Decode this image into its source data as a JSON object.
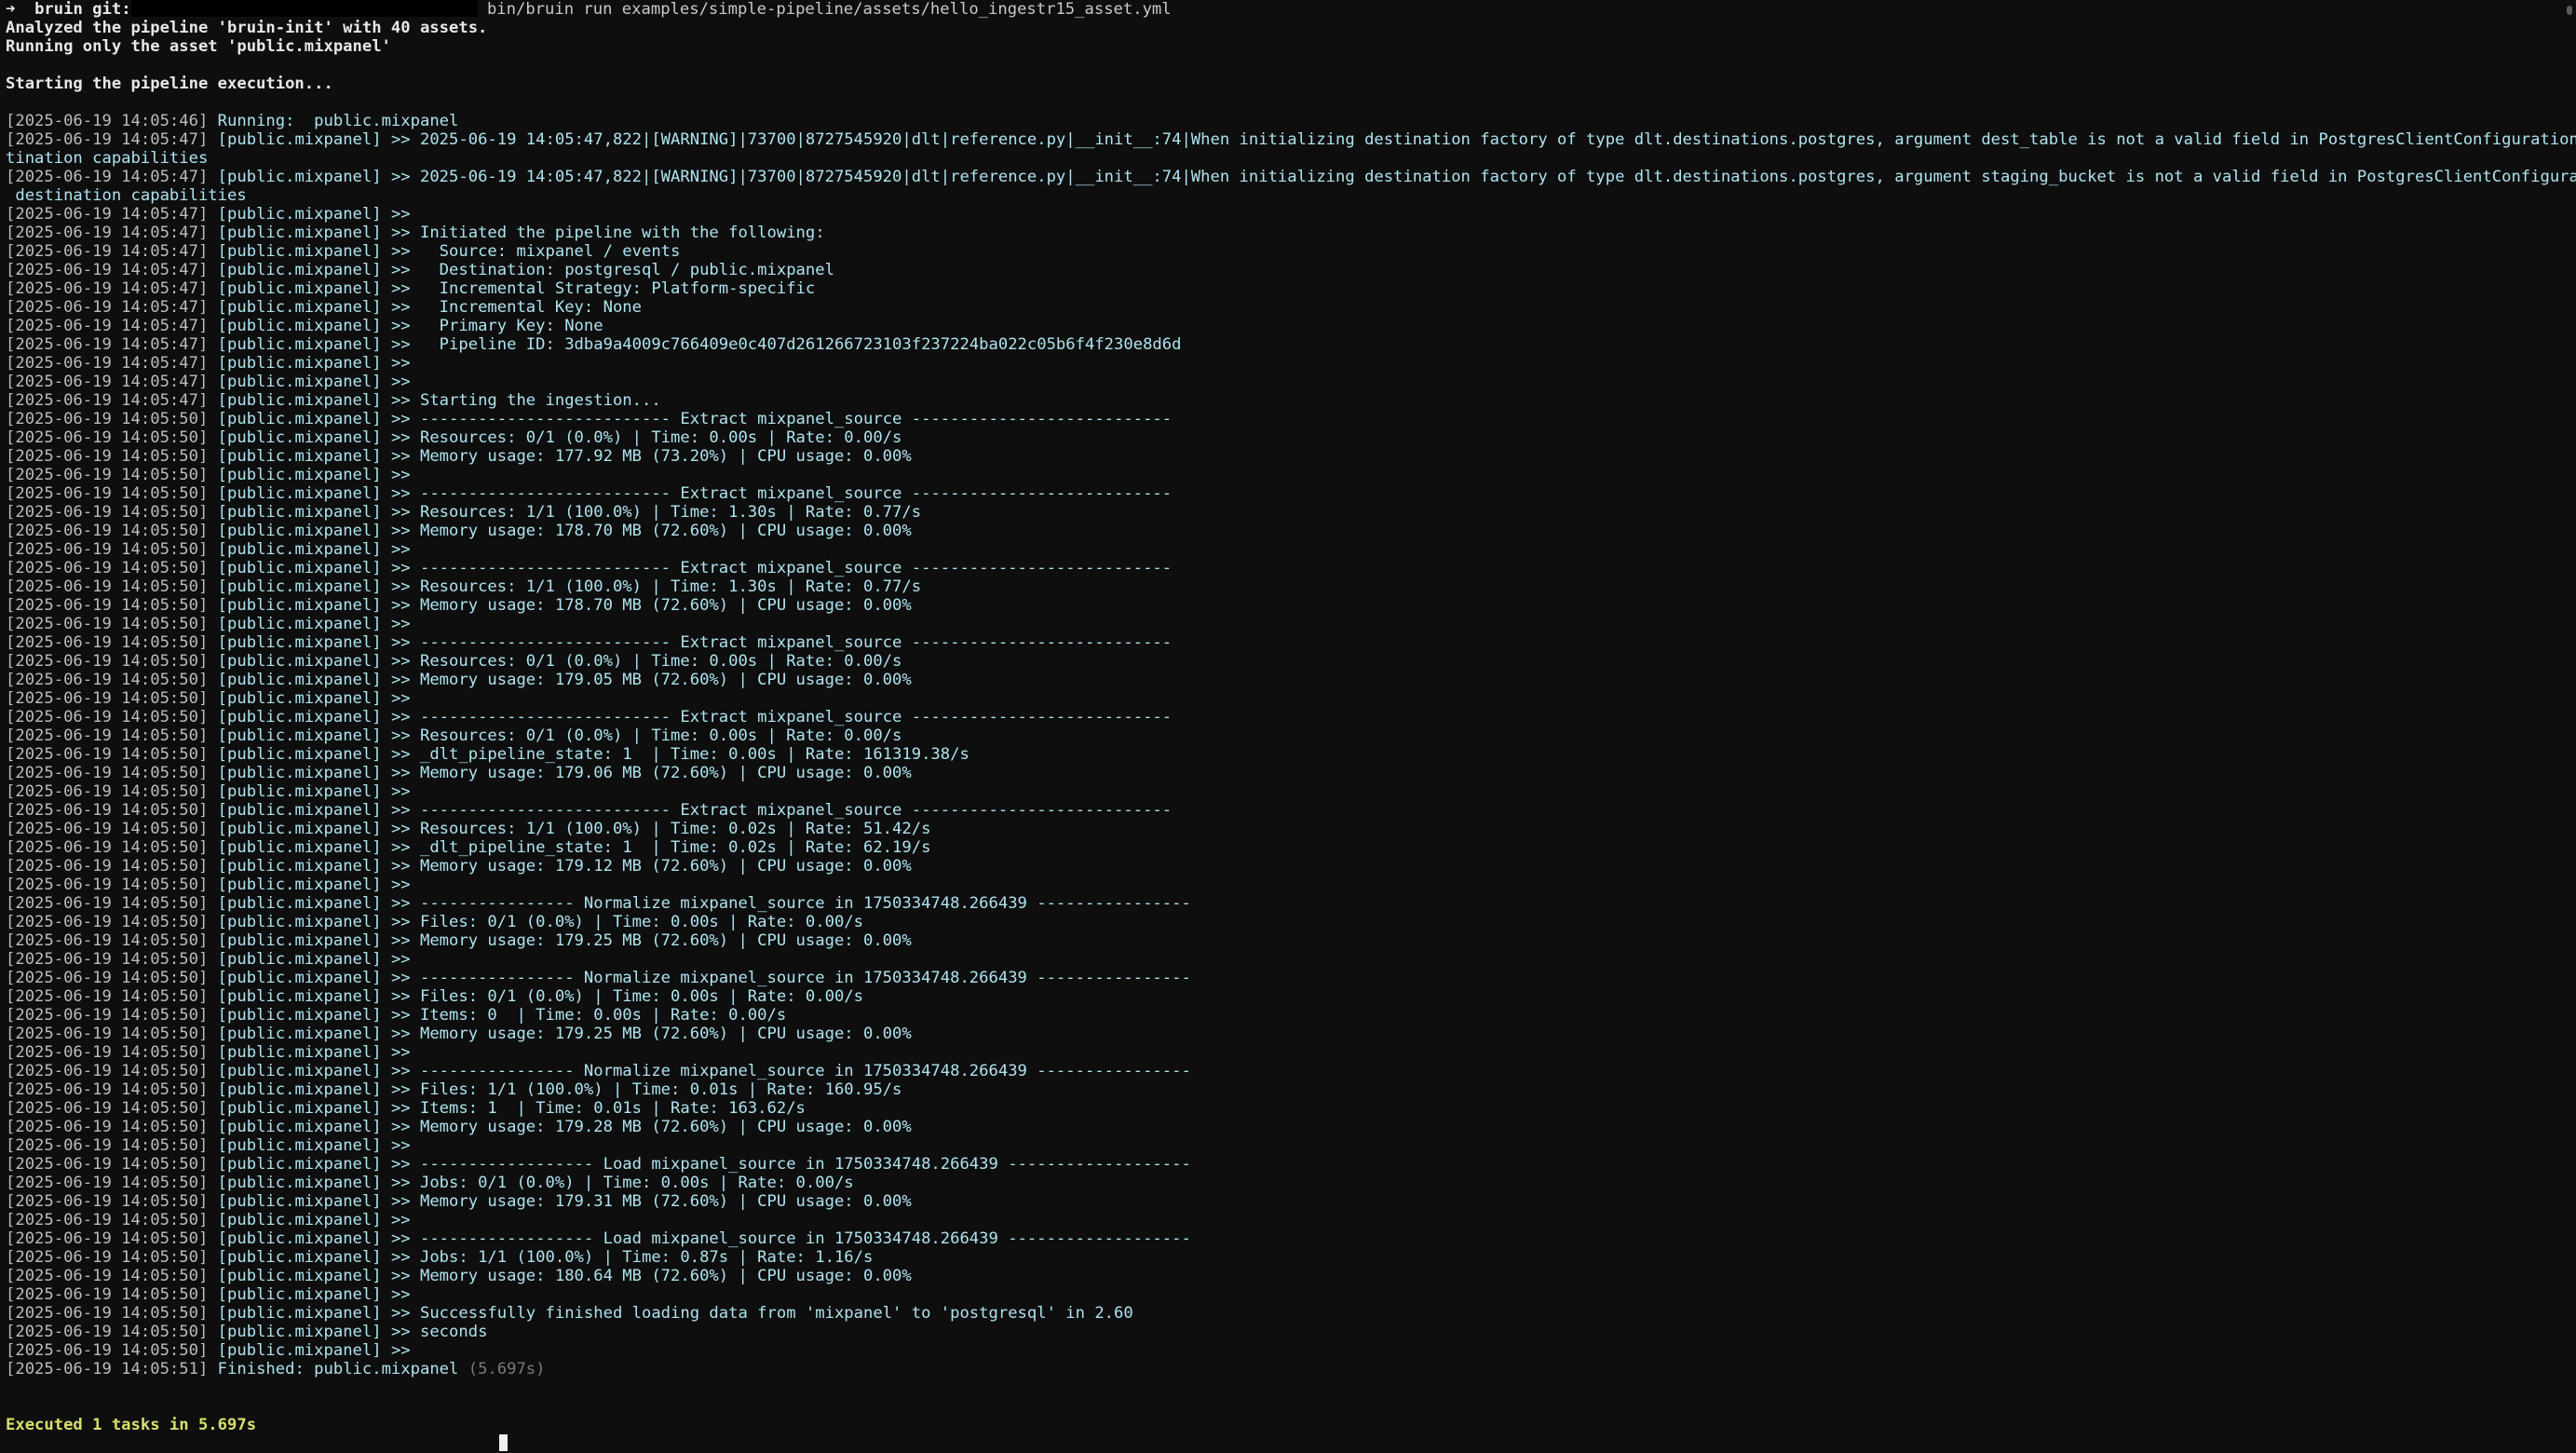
{
  "prompt": {
    "arrow": "➜",
    "dir": "bruin",
    "git_label": "git:",
    "command": "bin/bruin run examples/simple-pipeline/assets/hello_ingestr15_asset.yml"
  },
  "header": {
    "analyzed": "Analyzed the pipeline 'bruin-init' with 40 assets.",
    "running_only": "Running only the asset 'public.mixpanel'",
    "starting": "Starting the pipeline execution..."
  },
  "log": [
    {
      "ts": "[2025-06-19 14:05:46]",
      "asset": "Running:  public.mixpanel",
      "msg": ""
    },
    {
      "ts": "[2025-06-19 14:05:47]",
      "asset": "[public.mixpanel]",
      "msg": " >> 2025-06-19 14:05:47,822|[WARNING]|73700|8727545920|dlt|reference.py|__init__:74|When initializing destination factory of type dlt.destinations.postgres, argument dest_table is not a valid field in PostgresClientConfiguration or des",
      "cont": "tination capabilities"
    },
    {
      "ts": "[2025-06-19 14:05:47]",
      "asset": "[public.mixpanel]",
      "msg": " >> 2025-06-19 14:05:47,822|[WARNING]|73700|8727545920|dlt|reference.py|__init__:74|When initializing destination factory of type dlt.destinations.postgres, argument staging_bucket is not a valid field in PostgresClientConfiguration or",
      "cont": " destination capabilities"
    },
    {
      "ts": "[2025-06-19 14:05:47]",
      "asset": "[public.mixpanel]",
      "msg": " >>"
    },
    {
      "ts": "[2025-06-19 14:05:47]",
      "asset": "[public.mixpanel]",
      "msg": " >> Initiated the pipeline with the following:"
    },
    {
      "ts": "[2025-06-19 14:05:47]",
      "asset": "[public.mixpanel]",
      "msg": " >>   Source: mixpanel / events"
    },
    {
      "ts": "[2025-06-19 14:05:47]",
      "asset": "[public.mixpanel]",
      "msg": " >>   Destination: postgresql / public.mixpanel"
    },
    {
      "ts": "[2025-06-19 14:05:47]",
      "asset": "[public.mixpanel]",
      "msg": " >>   Incremental Strategy: Platform-specific"
    },
    {
      "ts": "[2025-06-19 14:05:47]",
      "asset": "[public.mixpanel]",
      "msg": " >>   Incremental Key: None"
    },
    {
      "ts": "[2025-06-19 14:05:47]",
      "asset": "[public.mixpanel]",
      "msg": " >>   Primary Key: None"
    },
    {
      "ts": "[2025-06-19 14:05:47]",
      "asset": "[public.mixpanel]",
      "msg": " >>   Pipeline ID: 3dba9a4009c766409e0c407d261266723103f237224ba022c05b6f4f230e8d6d"
    },
    {
      "ts": "[2025-06-19 14:05:47]",
      "asset": "[public.mixpanel]",
      "msg": " >>"
    },
    {
      "ts": "[2025-06-19 14:05:47]",
      "asset": "[public.mixpanel]",
      "msg": " >>"
    },
    {
      "ts": "[2025-06-19 14:05:47]",
      "asset": "[public.mixpanel]",
      "msg": " >> Starting the ingestion..."
    },
    {
      "ts": "[2025-06-19 14:05:50]",
      "asset": "[public.mixpanel]",
      "msg": " >> -------------------------- Extract mixpanel_source ---------------------------"
    },
    {
      "ts": "[2025-06-19 14:05:50]",
      "asset": "[public.mixpanel]",
      "msg": " >> Resources: 0/1 (0.0%) | Time: 0.00s | Rate: 0.00/s"
    },
    {
      "ts": "[2025-06-19 14:05:50]",
      "asset": "[public.mixpanel]",
      "msg": " >> Memory usage: 177.92 MB (73.20%) | CPU usage: 0.00%"
    },
    {
      "ts": "[2025-06-19 14:05:50]",
      "asset": "[public.mixpanel]",
      "msg": " >>"
    },
    {
      "ts": "[2025-06-19 14:05:50]",
      "asset": "[public.mixpanel]",
      "msg": " >> -------------------------- Extract mixpanel_source ---------------------------"
    },
    {
      "ts": "[2025-06-19 14:05:50]",
      "asset": "[public.mixpanel]",
      "msg": " >> Resources: 1/1 (100.0%) | Time: 1.30s | Rate: 0.77/s"
    },
    {
      "ts": "[2025-06-19 14:05:50]",
      "asset": "[public.mixpanel]",
      "msg": " >> Memory usage: 178.70 MB (72.60%) | CPU usage: 0.00%"
    },
    {
      "ts": "[2025-06-19 14:05:50]",
      "asset": "[public.mixpanel]",
      "msg": " >>"
    },
    {
      "ts": "[2025-06-19 14:05:50]",
      "asset": "[public.mixpanel]",
      "msg": " >> -------------------------- Extract mixpanel_source ---------------------------"
    },
    {
      "ts": "[2025-06-19 14:05:50]",
      "asset": "[public.mixpanel]",
      "msg": " >> Resources: 1/1 (100.0%) | Time: 1.30s | Rate: 0.77/s"
    },
    {
      "ts": "[2025-06-19 14:05:50]",
      "asset": "[public.mixpanel]",
      "msg": " >> Memory usage: 178.70 MB (72.60%) | CPU usage: 0.00%"
    },
    {
      "ts": "[2025-06-19 14:05:50]",
      "asset": "[public.mixpanel]",
      "msg": " >>"
    },
    {
      "ts": "[2025-06-19 14:05:50]",
      "asset": "[public.mixpanel]",
      "msg": " >> -------------------------- Extract mixpanel_source ---------------------------"
    },
    {
      "ts": "[2025-06-19 14:05:50]",
      "asset": "[public.mixpanel]",
      "msg": " >> Resources: 0/1 (0.0%) | Time: 0.00s | Rate: 0.00/s"
    },
    {
      "ts": "[2025-06-19 14:05:50]",
      "asset": "[public.mixpanel]",
      "msg": " >> Memory usage: 179.05 MB (72.60%) | CPU usage: 0.00%"
    },
    {
      "ts": "[2025-06-19 14:05:50]",
      "asset": "[public.mixpanel]",
      "msg": " >>"
    },
    {
      "ts": "[2025-06-19 14:05:50]",
      "asset": "[public.mixpanel]",
      "msg": " >> -------------------------- Extract mixpanel_source ---------------------------"
    },
    {
      "ts": "[2025-06-19 14:05:50]",
      "asset": "[public.mixpanel]",
      "msg": " >> Resources: 0/1 (0.0%) | Time: 0.00s | Rate: 0.00/s"
    },
    {
      "ts": "[2025-06-19 14:05:50]",
      "asset": "[public.mixpanel]",
      "msg": " >> _dlt_pipeline_state: 1  | Time: 0.00s | Rate: 161319.38/s"
    },
    {
      "ts": "[2025-06-19 14:05:50]",
      "asset": "[public.mixpanel]",
      "msg": " >> Memory usage: 179.06 MB (72.60%) | CPU usage: 0.00%"
    },
    {
      "ts": "[2025-06-19 14:05:50]",
      "asset": "[public.mixpanel]",
      "msg": " >>"
    },
    {
      "ts": "[2025-06-19 14:05:50]",
      "asset": "[public.mixpanel]",
      "msg": " >> -------------------------- Extract mixpanel_source ---------------------------"
    },
    {
      "ts": "[2025-06-19 14:05:50]",
      "asset": "[public.mixpanel]",
      "msg": " >> Resources: 1/1 (100.0%) | Time: 0.02s | Rate: 51.42/s"
    },
    {
      "ts": "[2025-06-19 14:05:50]",
      "asset": "[public.mixpanel]",
      "msg": " >> _dlt_pipeline_state: 1  | Time: 0.02s | Rate: 62.19/s"
    },
    {
      "ts": "[2025-06-19 14:05:50]",
      "asset": "[public.mixpanel]",
      "msg": " >> Memory usage: 179.12 MB (72.60%) | CPU usage: 0.00%"
    },
    {
      "ts": "[2025-06-19 14:05:50]",
      "asset": "[public.mixpanel]",
      "msg": " >>"
    },
    {
      "ts": "[2025-06-19 14:05:50]",
      "asset": "[public.mixpanel]",
      "msg": " >> ---------------- Normalize mixpanel_source in 1750334748.266439 ----------------"
    },
    {
      "ts": "[2025-06-19 14:05:50]",
      "asset": "[public.mixpanel]",
      "msg": " >> Files: 0/1 (0.0%) | Time: 0.00s | Rate: 0.00/s"
    },
    {
      "ts": "[2025-06-19 14:05:50]",
      "asset": "[public.mixpanel]",
      "msg": " >> Memory usage: 179.25 MB (72.60%) | CPU usage: 0.00%"
    },
    {
      "ts": "[2025-06-19 14:05:50]",
      "asset": "[public.mixpanel]",
      "msg": " >>"
    },
    {
      "ts": "[2025-06-19 14:05:50]",
      "asset": "[public.mixpanel]",
      "msg": " >> ---------------- Normalize mixpanel_source in 1750334748.266439 ----------------"
    },
    {
      "ts": "[2025-06-19 14:05:50]",
      "asset": "[public.mixpanel]",
      "msg": " >> Files: 0/1 (0.0%) | Time: 0.00s | Rate: 0.00/s"
    },
    {
      "ts": "[2025-06-19 14:05:50]",
      "asset": "[public.mixpanel]",
      "msg": " >> Items: 0  | Time: 0.00s | Rate: 0.00/s"
    },
    {
      "ts": "[2025-06-19 14:05:50]",
      "asset": "[public.mixpanel]",
      "msg": " >> Memory usage: 179.25 MB (72.60%) | CPU usage: 0.00%"
    },
    {
      "ts": "[2025-06-19 14:05:50]",
      "asset": "[public.mixpanel]",
      "msg": " >>"
    },
    {
      "ts": "[2025-06-19 14:05:50]",
      "asset": "[public.mixpanel]",
      "msg": " >> ---------------- Normalize mixpanel_source in 1750334748.266439 ----------------"
    },
    {
      "ts": "[2025-06-19 14:05:50]",
      "asset": "[public.mixpanel]",
      "msg": " >> Files: 1/1 (100.0%) | Time: 0.01s | Rate: 160.95/s"
    },
    {
      "ts": "[2025-06-19 14:05:50]",
      "asset": "[public.mixpanel]",
      "msg": " >> Items: 1  | Time: 0.01s | Rate: 163.62/s"
    },
    {
      "ts": "[2025-06-19 14:05:50]",
      "asset": "[public.mixpanel]",
      "msg": " >> Memory usage: 179.28 MB (72.60%) | CPU usage: 0.00%"
    },
    {
      "ts": "[2025-06-19 14:05:50]",
      "asset": "[public.mixpanel]",
      "msg": " >>"
    },
    {
      "ts": "[2025-06-19 14:05:50]",
      "asset": "[public.mixpanel]",
      "msg": " >> ------------------ Load mixpanel_source in 1750334748.266439 -------------------"
    },
    {
      "ts": "[2025-06-19 14:05:50]",
      "asset": "[public.mixpanel]",
      "msg": " >> Jobs: 0/1 (0.0%) | Time: 0.00s | Rate: 0.00/s"
    },
    {
      "ts": "[2025-06-19 14:05:50]",
      "asset": "[public.mixpanel]",
      "msg": " >> Memory usage: 179.31 MB (72.60%) | CPU usage: 0.00%"
    },
    {
      "ts": "[2025-06-19 14:05:50]",
      "asset": "[public.mixpanel]",
      "msg": " >>"
    },
    {
      "ts": "[2025-06-19 14:05:50]",
      "asset": "[public.mixpanel]",
      "msg": " >> ------------------ Load mixpanel_source in 1750334748.266439 -------------------"
    },
    {
      "ts": "[2025-06-19 14:05:50]",
      "asset": "[public.mixpanel]",
      "msg": " >> Jobs: 1/1 (100.0%) | Time: 0.87s | Rate: 1.16/s"
    },
    {
      "ts": "[2025-06-19 14:05:50]",
      "asset": "[public.mixpanel]",
      "msg": " >> Memory usage: 180.64 MB (72.60%) | CPU usage: 0.00%"
    },
    {
      "ts": "[2025-06-19 14:05:50]",
      "asset": "[public.mixpanel]",
      "msg": " >>"
    },
    {
      "ts": "[2025-06-19 14:05:50]",
      "asset": "[public.mixpanel]",
      "msg": " >> Successfully finished loading data from 'mixpanel' to 'postgresql' in 2.60"
    },
    {
      "ts": "[2025-06-19 14:05:50]",
      "asset": "[public.mixpanel]",
      "msg": " >> seconds"
    },
    {
      "ts": "[2025-06-19 14:05:50]",
      "asset": "[public.mixpanel]",
      "msg": " >>"
    },
    {
      "ts": "[2025-06-19 14:05:51]",
      "asset": "Finished: public.mixpanel",
      "msg": "",
      "dim": " (5.697s)"
    }
  ],
  "footer": {
    "executed": "Executed 1 tasks in 5.697s"
  }
}
